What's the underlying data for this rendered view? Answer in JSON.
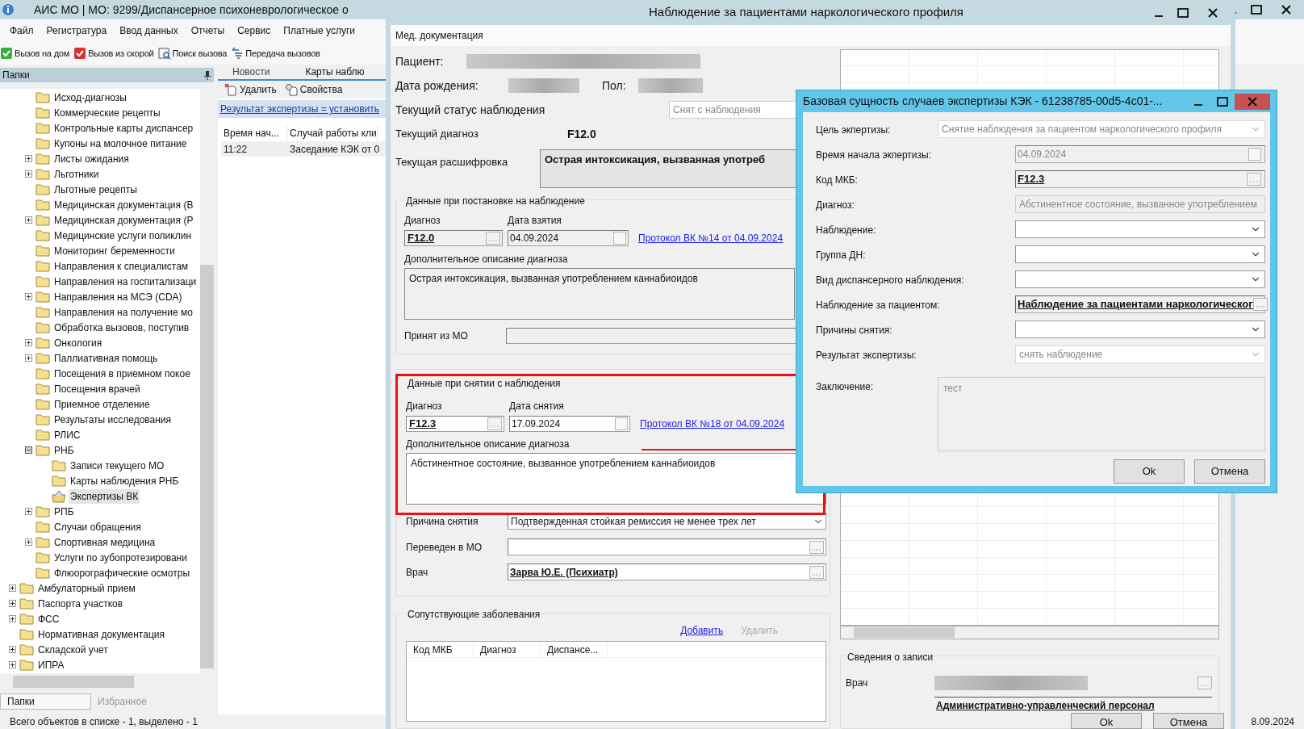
{
  "main_window": {
    "title": "АИС МО | МО: 9299/Диспансерное психоневрологическое о",
    "menu": [
      "Файл",
      "Регистратура",
      "Ввод данных",
      "Отчеты",
      "Сервис",
      "Платные услуги"
    ],
    "toolbar": [
      {
        "label": "Вызов на дом",
        "kind": "home"
      },
      {
        "label": "Вызов из скорой",
        "kind": "ambulance"
      },
      {
        "label": "Поиск вызова",
        "kind": "search"
      },
      {
        "label": "Передача вызовов",
        "kind": "transfer"
      }
    ],
    "folders_panel": {
      "title": "Папки",
      "tree": {
        "continued": [
          {
            "label": "Исход-диагнозы",
            "selected": false
          },
          {
            "label": "Коммерческие рецепты",
            "selected": false
          },
          {
            "label": "Контрольные карты диспансер",
            "selected": false
          },
          {
            "label": "Купоны на молочное питание",
            "selected": false
          },
          {
            "label": "Листы ожидания",
            "expandable": true,
            "expanded": false,
            "selected": false
          },
          {
            "label": "Льготники",
            "expandable": true,
            "expanded": false,
            "selected": false
          },
          {
            "label": "Льготные рецепты",
            "selected": false
          },
          {
            "label": "Медицинская документация (В",
            "selected": false
          },
          {
            "label": "Медицинская документация (Р",
            "expandable": true,
            "expanded": false,
            "selected": false
          },
          {
            "label": "Медицинские услуги поликлин",
            "selected": false
          },
          {
            "label": "Мониторинг беременности",
            "selected": false
          },
          {
            "label": "Направления к специалистам",
            "selected": false
          },
          {
            "label": "Направления на госпитализаци",
            "selected": false
          },
          {
            "label": "Направления на МСЭ (CDA)",
            "expandable": true,
            "expanded": false,
            "selected": false
          },
          {
            "label": "Направления на получение мо",
            "selected": false
          },
          {
            "label": "Обработка вызовов, поступив",
            "selected": false
          },
          {
            "label": "Онкология",
            "expandable": true,
            "expanded": false,
            "selected": false
          },
          {
            "label": "Паллиативная помощь",
            "expandable": true,
            "expanded": false,
            "selected": false
          },
          {
            "label": "Посещения в приемном покое",
            "selected": false
          },
          {
            "label": "Посещения врачей",
            "selected": false
          },
          {
            "label": "Приемное отделение",
            "selected": false
          },
          {
            "label": "Результаты исследования",
            "selected": false
          },
          {
            "label": "РЛИС",
            "selected": false
          },
          {
            "label": "РНБ",
            "expandable": true,
            "expanded": true,
            "selected": false,
            "children": [
              {
                "label": "Записи текущего МО",
                "selected": false
              },
              {
                "label": "Карты наблюдения РНБ",
                "selected": false
              },
              {
                "label": "Экспертизы ВК",
                "selected": true
              }
            ]
          },
          {
            "label": "РПБ",
            "expandable": true,
            "expanded": false,
            "selected": false
          },
          {
            "label": "Случаи обращения",
            "selected": false
          },
          {
            "label": "Спортивная медицина",
            "expandable": true,
            "expanded": false,
            "selected": false
          },
          {
            "label": "Услуги по зубопротезировани",
            "selected": false
          },
          {
            "label": "Флюорографические осмотры",
            "selected": false
          }
        ],
        "roots": [
          {
            "label": "Амбулаторный прием",
            "expandable": true,
            "expanded": false,
            "selected": false
          },
          {
            "label": "Паспорта участков",
            "expandable": true,
            "expanded": false,
            "selected": false
          },
          {
            "label": "ФСС",
            "expandable": true,
            "expanded": false,
            "selected": false
          },
          {
            "label": "Нормативная документация",
            "selected": false
          },
          {
            "label": "Складской учет",
            "expandable": true,
            "expanded": false,
            "selected": false
          },
          {
            "label": "ИПРА",
            "expandable": true,
            "expanded": false,
            "selected": false
          }
        ]
      },
      "tabs": [
        {
          "label": "Папки",
          "selected": true
        },
        {
          "label": "Избранное",
          "selected": false
        }
      ]
    },
    "content": {
      "tabs": [
        {
          "label": "Новости",
          "selected": false
        },
        {
          "label": "Карты наблю",
          "selected": true
        }
      ],
      "actions": [
        {
          "label": "Удалить",
          "kind": "delete"
        },
        {
          "label": "Свойства",
          "kind": "properties"
        }
      ],
      "filter": "Результат экспертизы = установить",
      "table": {
        "columns": [
          "Время нач...",
          "Случай работы кли"
        ],
        "rows": [
          {
            "cells": [
              "11:22",
              "Заседание КЭК от 0"
            ],
            "selected": true
          }
        ]
      }
    },
    "status_bar": "Всего объектов в списке - 1, выделено - 1",
    "status_date": "8.09.2024"
  },
  "observation_window": {
    "title": "Наблюдение за пациентами наркологического профиля",
    "tabs": [
      {
        "label": "Мед. документация",
        "selected": true
      }
    ],
    "patient_label": "Пациент:",
    "birth_label": "Дата рождения:",
    "sex_label": "Пол:",
    "status_label": "Текущий статус наблюдения",
    "status_value": "Снят с наблюдения",
    "diagnosis_label": "Текущий диагноз",
    "diagnosis_value": "F12.0",
    "decoding_label": "Текущая расшифровка",
    "decoding_value": "Острая интоксикация, вызванная употреб",
    "registration": {
      "title": "Данные при постановке на наблюдение",
      "diagnosis_label": "Диагноз",
      "diagnosis": "F12.0",
      "date_label": "Дата взятия",
      "date": "04.09.2024",
      "protocol_link": "Протокол ВК №14 от 04.09.2024",
      "description_label": "Дополнительное описание диагноза",
      "description": "Острая интоксикация, вызванная употреблением каннабиоидов",
      "from_mo_label": "Принят из МО"
    },
    "removal": {
      "title": "Данные при снятии с наблюдения",
      "diagnosis_label": "Диагноз",
      "diagnosis": "F12.3",
      "date_label": "Дата снятия",
      "date": "17.09.2024",
      "protocol_link": "Протокол ВК №18 от 04.09.2024",
      "description_label": "Дополнительное описание диагноза",
      "description": "Абстинентное состояние, вызванное употреблением каннабиоидов",
      "reason_label": "Причина снятия",
      "reason": "Подтвержденная стойкая ремиссия не менее трех лет",
      "transferred_label": "Переведен в МО",
      "doctor_label": "Врач",
      "doctor": "Зарва Ю.Е. (Психиатр)"
    },
    "comorbidities": {
      "title": "Сопутствующие заболевания",
      "add": "Добавить",
      "remove": "Удалить",
      "remove_disabled": true,
      "columns": [
        "Код МКБ",
        "Диагноз",
        "Диспансе..."
      ]
    },
    "record_info": {
      "title": "Сведения о записи",
      "doctor_label": "Врач",
      "staff": "Административно-управленческий персонал"
    },
    "buttons": [
      "Ok",
      "Отмена"
    ]
  },
  "expertise_dialog": {
    "title": "Базовая сущность случаев экспертизы КЭК - 61238785-00d5-4c01-...",
    "fields": [
      {
        "label": "Цель экпертизы:",
        "kind": "select",
        "value": "Снятие наблюдения за пациентом наркологического профиля",
        "disabled": true,
        "wide": true
      },
      {
        "label": "Время начала экпертизы:",
        "kind": "date",
        "value": "04.09.2024",
        "disabled": true
      },
      {
        "label": "Код МКБ:",
        "kind": "lookup",
        "value": "F12.3",
        "disabled": false
      },
      {
        "label": "Диагноз:",
        "kind": "text",
        "value": "Абстинентное состояние, вызванное употреблением",
        "disabled": true
      },
      {
        "label": "Наблюдение:",
        "kind": "select",
        "disabled": false
      },
      {
        "label": "Группа ДН:",
        "kind": "select",
        "disabled": false
      },
      {
        "label": "Вид диспансерного наблюдения:",
        "kind": "select",
        "disabled": false
      },
      {
        "label": "Наблюдение за пациентом:",
        "kind": "lookup",
        "value": "Наблюдение за пациентами наркологическог",
        "disabled": false
      },
      {
        "label": "Причины снятия:",
        "kind": "select",
        "disabled": false
      },
      {
        "label": "Результат экспертизы:",
        "kind": "select",
        "value": "снять наблюдение",
        "disabled": true
      },
      {
        "label": "Заключение:",
        "kind": "textarea",
        "value": "тест",
        "disabled": true,
        "wide": true
      }
    ],
    "buttons": [
      "Ok",
      "Отмена"
    ]
  }
}
